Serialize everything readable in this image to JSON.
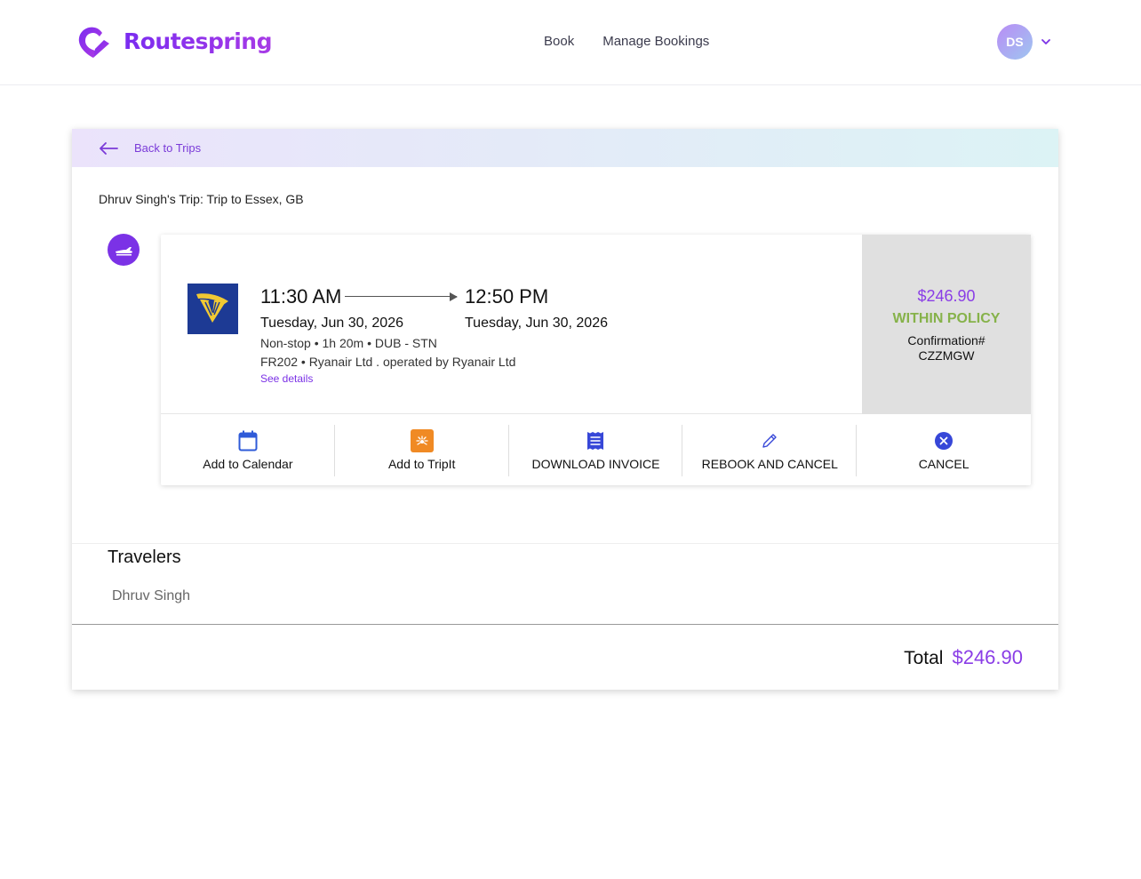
{
  "header": {
    "brand": "Routespring",
    "nav": [
      {
        "label": "Book"
      },
      {
        "label": "Manage Bookings"
      }
    ],
    "avatar_initials": "DS",
    "brand_color": "#8a2be2"
  },
  "trip": {
    "back_label": "Back to Trips",
    "title": "Dhruv Singh's Trip: Trip to Essex, GB"
  },
  "flight": {
    "departure_time": "11:30 AM",
    "arrival_time": "12:50 PM",
    "departure_date": "Tuesday, Jun 30, 2026",
    "arrival_date": "Tuesday, Jun 30, 2026",
    "summary": "Non-stop • 1h 20m • DUB - STN",
    "carrier": "FR202 • Ryanair Ltd . operated by Ryanair Ltd",
    "details_link": "See details",
    "price": "$246.90",
    "policy": "WITHIN POLICY",
    "confirmation_label": "Confirmation#",
    "confirmation_code": "CZZMGW",
    "airline_icon": "ryanair-harp-logo"
  },
  "actions": [
    {
      "label": "Add to Calendar",
      "icon": "calendar-icon"
    },
    {
      "label": "Add to TripIt",
      "icon": "tripit-icon"
    },
    {
      "label": "DOWNLOAD INVOICE",
      "icon": "invoice-icon"
    },
    {
      "label": "REBOOK AND CANCEL",
      "icon": "pencil-icon"
    },
    {
      "label": "CANCEL",
      "icon": "cancel-circle-icon"
    }
  ],
  "travelers": {
    "title": "Travelers",
    "names": [
      "Dhruv Singh"
    ]
  },
  "total": {
    "label": "Total",
    "value": "$246.90"
  }
}
